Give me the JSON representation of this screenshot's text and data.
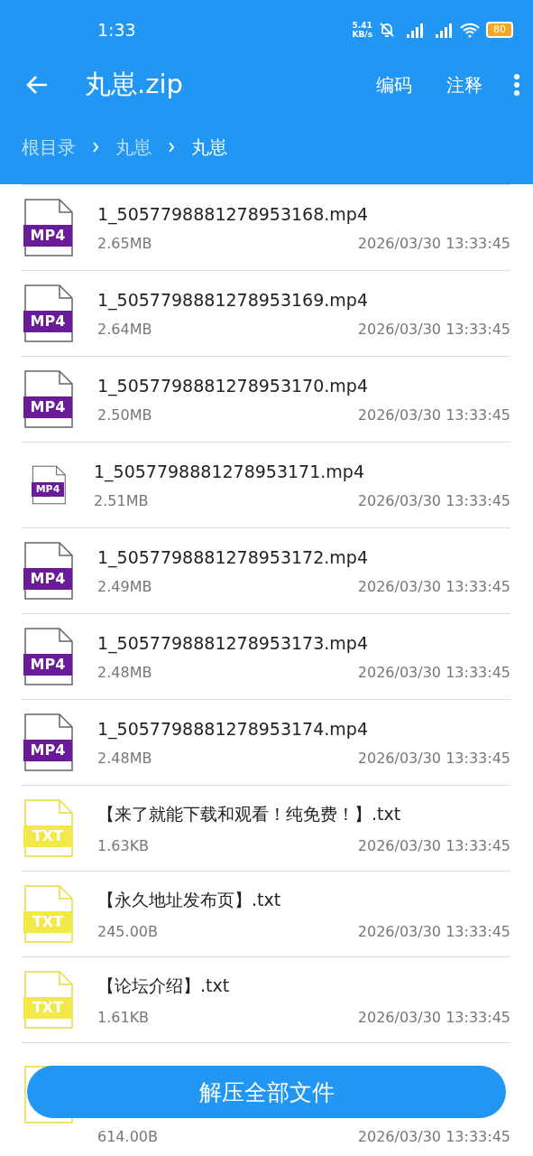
{
  "status_bar": {
    "time": "1:33",
    "net_speed_value": "5.41",
    "net_speed_unit": "KB/s",
    "battery": "80"
  },
  "toolbar": {
    "title": "丸崽.zip",
    "actions": [
      "编码",
      "注释"
    ]
  },
  "breadcrumb": [
    {
      "label": "根目录",
      "selected": false
    },
    {
      "label": "丸崽",
      "selected": false
    },
    {
      "label": "丸崽",
      "selected": true
    }
  ],
  "files": [
    {
      "kind": "mp4",
      "badge": "MP4",
      "small_icon": false,
      "name": "1_5057798881278953168.mp4",
      "size": "2.65MB",
      "date": "2026/03/30 13:33:45"
    },
    {
      "kind": "mp4",
      "badge": "MP4",
      "small_icon": false,
      "name": "1_5057798881278953169.mp4",
      "size": "2.64MB",
      "date": "2026/03/30 13:33:45"
    },
    {
      "kind": "mp4",
      "badge": "MP4",
      "small_icon": false,
      "name": "1_5057798881278953170.mp4",
      "size": "2.50MB",
      "date": "2026/03/30 13:33:45"
    },
    {
      "kind": "mp4",
      "badge": "MP4",
      "small_icon": true,
      "name": "1_5057798881278953171.mp4",
      "size": "2.51MB",
      "date": "2026/03/30 13:33:45"
    },
    {
      "kind": "mp4",
      "badge": "MP4",
      "small_icon": false,
      "name": "1_5057798881278953172.mp4",
      "size": "2.49MB",
      "date": "2026/03/30 13:33:45"
    },
    {
      "kind": "mp4",
      "badge": "MP4",
      "small_icon": false,
      "name": "1_5057798881278953173.mp4",
      "size": "2.48MB",
      "date": "2026/03/30 13:33:45"
    },
    {
      "kind": "mp4",
      "badge": "MP4",
      "small_icon": false,
      "name": "1_5057798881278953174.mp4",
      "size": "2.48MB",
      "date": "2026/03/30 13:33:45"
    },
    {
      "kind": "txt",
      "badge": "TXT",
      "small_icon": false,
      "name": "【来了就能下载和观看！纯免费！】.txt",
      "size": "1.63KB",
      "date": "2026/03/30 13:33:45"
    },
    {
      "kind": "txt",
      "badge": "TXT",
      "small_icon": false,
      "name": "【永久地址发布页】.txt",
      "size": "245.00B",
      "date": "2026/03/30 13:33:45"
    },
    {
      "kind": "txt",
      "badge": "TXT",
      "small_icon": false,
      "name": "【论坛介绍】.txt",
      "size": "1.61KB",
      "date": "2026/03/30 13:33:45"
    },
    {
      "kind": "txt",
      "small_icon": false,
      "size": "614.00B",
      "date": "2026/03/30 13:33:45"
    }
  ],
  "extract_button": "解压全部文件"
}
